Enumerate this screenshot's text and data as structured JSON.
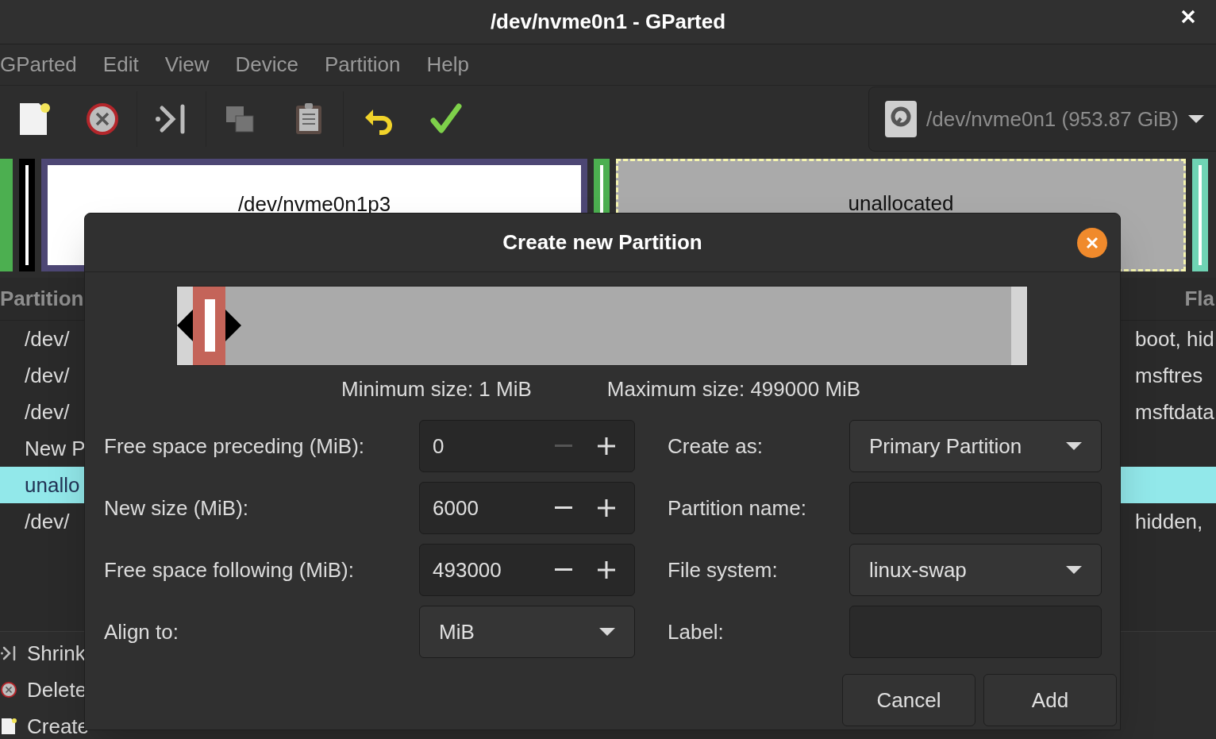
{
  "window": {
    "title": "/dev/nvme0n1 - GParted"
  },
  "menu": [
    "GParted",
    "Edit",
    "View",
    "Device",
    "Partition",
    "Help"
  ],
  "toolbar": [
    {
      "kind": "new",
      "disabled": false
    },
    {
      "kind": "delete",
      "disabled": false
    },
    {
      "kind": "resize",
      "disabled": false
    },
    {
      "kind": "copy",
      "disabled": true
    },
    {
      "kind": "paste",
      "disabled": false
    },
    {
      "kind": "undo",
      "disabled": false
    },
    {
      "kind": "apply",
      "disabled": false
    }
  ],
  "device": {
    "label": "/dev/nvme0n1 (953.87 GiB)"
  },
  "disk_map": [
    {
      "kind": "partition",
      "color": "#4caf50"
    },
    {
      "kind": "partition",
      "color": "#000000"
    },
    {
      "kind": "partition",
      "color": "#4d4774",
      "label": "/dev/nvme0n1p3"
    },
    {
      "kind": "partition",
      "color": "#4caf50"
    },
    {
      "kind": "unallocated",
      "color": "#f5f5b0",
      "label": "unallocated"
    },
    {
      "kind": "partition",
      "color": "#6fd3b4"
    }
  ],
  "table": {
    "columns": [
      "Partition",
      "Fla"
    ],
    "rows": [
      {
        "partition": "/dev/",
        "flags": "boot, hid",
        "selected": false
      },
      {
        "partition": "/dev/",
        "flags": "msftres",
        "selected": false
      },
      {
        "partition": "/dev/",
        "flags": "msftdata",
        "selected": false
      },
      {
        "partition": "New P",
        "selected": false
      },
      {
        "partition": "unallo",
        "selected": true
      },
      {
        "partition": "/dev/",
        "flags": "hidden,",
        "selected": false
      }
    ]
  },
  "operations": [
    {
      "kind": "resize",
      "text": "Shrink"
    },
    {
      "kind": "delete",
      "text": "Delete"
    },
    {
      "kind": "new",
      "text": "Create"
    }
  ],
  "dialog": {
    "title": "Create new Partition",
    "slider": {
      "level": 0.04
    },
    "min_label": "Minimum size: 1 MiB",
    "max_label": "Maximum size: 499000 MiB",
    "left_fields": [
      {
        "label": "Free space preceding (MiB):",
        "kind": "spin",
        "value": "0",
        "decrement_disabled": true
      },
      {
        "label": "New size (MiB):",
        "kind": "spin",
        "value": "6000",
        "decrement_disabled": false
      },
      {
        "label": "Free space following (MiB):",
        "kind": "spin",
        "value": "493000",
        "decrement_disabled": false
      },
      {
        "label": "Align to:",
        "kind": "dropdown",
        "value": "MiB"
      }
    ],
    "right_fields": [
      {
        "label": "Create as:",
        "kind": "dropdown",
        "value": "Primary Partition"
      },
      {
        "label": "Partition name:",
        "kind": "text"
      },
      {
        "label": "File system:",
        "kind": "dropdown",
        "value": "linux-swap"
      },
      {
        "label": "Label:",
        "kind": "text"
      }
    ],
    "buttons": [
      "Cancel",
      "Add"
    ]
  }
}
